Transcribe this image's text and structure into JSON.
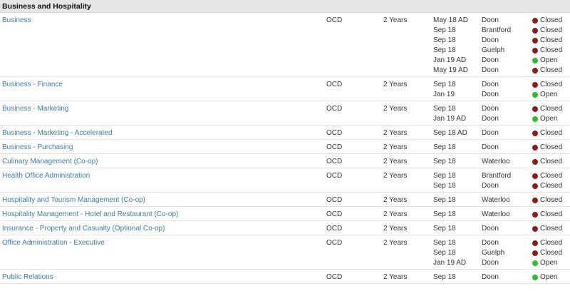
{
  "section": {
    "title": "Business and Hospitality"
  },
  "colors": {
    "closed": "#8b1c1c",
    "open": "#2ebd2e",
    "link": "#3f7ca5"
  },
  "programs": [
    {
      "name": "Business",
      "credential": "OCD",
      "duration": "2 Years",
      "offerings": [
        {
          "intake": "May 18 AD",
          "campus": "Doon",
          "status": "Closed"
        },
        {
          "intake": "Sep 18",
          "campus": "Brantford",
          "status": "Closed"
        },
        {
          "intake": "Sep 18",
          "campus": "Doon",
          "status": "Closed"
        },
        {
          "intake": "Sep 18",
          "campus": "Guelph",
          "status": "Closed"
        },
        {
          "intake": "Jan 19 AD",
          "campus": "Doon",
          "status": "Open"
        },
        {
          "intake": "May 19 AD",
          "campus": "Doon",
          "status": "Closed"
        }
      ]
    },
    {
      "name": "Business - Finance",
      "credential": "OCD",
      "duration": "2 Years",
      "offerings": [
        {
          "intake": "Sep 18",
          "campus": "Doon",
          "status": "Closed"
        },
        {
          "intake": "Jan 19",
          "campus": "Doon",
          "status": "Open"
        }
      ]
    },
    {
      "name": "Business - Marketing",
      "credential": "OCD",
      "duration": "2 Years",
      "offerings": [
        {
          "intake": "Sep 18",
          "campus": "Doon",
          "status": "Closed"
        },
        {
          "intake": "Jan 19 AD",
          "campus": "Doon",
          "status": "Open"
        }
      ]
    },
    {
      "name": "Business - Marketing - Accelerated",
      "credential": "OCD",
      "duration": "2 Years",
      "offerings": [
        {
          "intake": "Sep 18 AD",
          "campus": "Doon",
          "status": "Closed"
        }
      ]
    },
    {
      "name": "Business - Purchasing",
      "credential": "OCD",
      "duration": "2 Years",
      "offerings": [
        {
          "intake": "Sep 18",
          "campus": "Doon",
          "status": "Closed"
        }
      ]
    },
    {
      "name": "Culinary Management (Co-op)",
      "credential": "OCD",
      "duration": "2 Years",
      "offerings": [
        {
          "intake": "Sep 18",
          "campus": "Waterloo",
          "status": "Closed"
        }
      ]
    },
    {
      "name": "Health Office Administration",
      "credential": "OCD",
      "duration": "2 Years",
      "offerings": [
        {
          "intake": "Sep 18",
          "campus": "Brantford",
          "status": "Closed"
        },
        {
          "intake": "Sep 18",
          "campus": "Doon",
          "status": "Closed"
        }
      ]
    },
    {
      "name": "Hospitality and Tourism Management (Co-op)",
      "credential": "OCD",
      "duration": "2 Years",
      "offerings": [
        {
          "intake": "Sep 18",
          "campus": "Waterloo",
          "status": "Closed"
        }
      ]
    },
    {
      "name": "Hospitality Management - Hotel and Restaurant (Co-op)",
      "credential": "OCD",
      "duration": "2 Years",
      "offerings": [
        {
          "intake": "Sep 18",
          "campus": "Waterloo",
          "status": "Closed"
        }
      ]
    },
    {
      "name": "Insurance - Property and Casualty (Optional Co-op)",
      "credential": "OCD",
      "duration": "2 Years",
      "offerings": [
        {
          "intake": "Sep 18",
          "campus": "Doon",
          "status": "Closed"
        }
      ]
    },
    {
      "name": "Office Administration - Executive",
      "credential": "OCD",
      "duration": "2 Years",
      "offerings": [
        {
          "intake": "Sep 18",
          "campus": "Doon",
          "status": "Closed"
        },
        {
          "intake": "Sep 18",
          "campus": "Guelph",
          "status": "Closed"
        },
        {
          "intake": "Jan 19 AD",
          "campus": "Doon",
          "status": "Open"
        }
      ]
    },
    {
      "name": "Public Relations",
      "credential": "OCD",
      "duration": "2 Years",
      "offerings": [
        {
          "intake": "Sep 18",
          "campus": "Doon",
          "status": "Open"
        }
      ]
    }
  ]
}
